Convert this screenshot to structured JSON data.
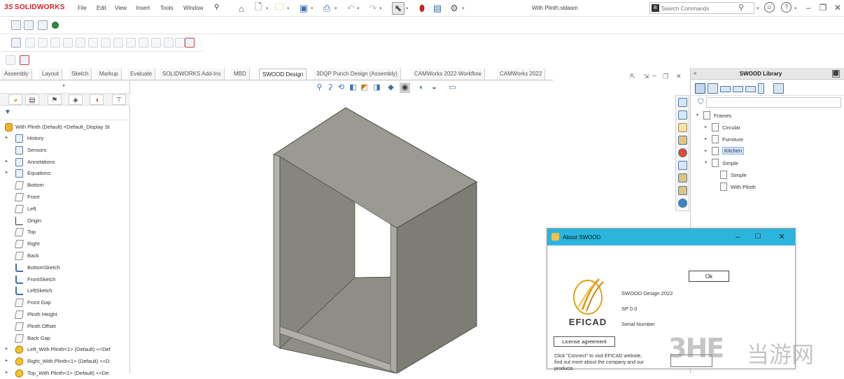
{
  "title_bar": {
    "logo_text": "SOLIDWORKS",
    "logo_mark": "3S",
    "menus": [
      "File",
      "Edit",
      "View",
      "Insert",
      "Tools",
      "Window"
    ],
    "document_title": "With Plinth.sldasm",
    "search_placeholder": "Search Commands",
    "search_logo": "B"
  },
  "command_tabs": [
    "Assembly",
    "Layout",
    "Sketch",
    "Markup",
    "Evaluate",
    "SOLIDWORKS Add-Ins",
    "MBD",
    "SWOOD Design",
    "3DQP Punch Design (Assembly)",
    "CAMWorks 2022-Workflow",
    "CAMWorks 2022"
  ],
  "active_command_tab": "SWOOD Design",
  "feature_tree": {
    "filter_symbol": "▼",
    "root": "With Plinth (Default) <Default_Display St",
    "items": [
      {
        "label": "History",
        "icon": "history-icon",
        "expand": "▸"
      },
      {
        "label": "Sensors",
        "icon": "sensors-icon",
        "expand": ""
      },
      {
        "label": "Annotations",
        "icon": "annotations-icon",
        "expand": "▸"
      },
      {
        "label": "Equations",
        "icon": "equations-icon",
        "expand": "▸"
      },
      {
        "label": "Bottom",
        "icon": "plane-icon",
        "expand": ""
      },
      {
        "label": "Front",
        "icon": "plane-icon",
        "expand": ""
      },
      {
        "label": "Left",
        "icon": "plane-icon",
        "expand": ""
      },
      {
        "label": "Origin",
        "icon": "origin-icon",
        "expand": ""
      },
      {
        "label": "Top",
        "icon": "plane-icon",
        "expand": ""
      },
      {
        "label": "Right",
        "icon": "plane-icon",
        "expand": ""
      },
      {
        "label": "Back",
        "icon": "plane-icon",
        "expand": ""
      },
      {
        "label": "BottomSketch",
        "icon": "sketch-icon",
        "expand": ""
      },
      {
        "label": "FrontSketch",
        "icon": "sketch-icon",
        "expand": ""
      },
      {
        "label": "LeftSketch",
        "icon": "sketch-icon",
        "expand": ""
      },
      {
        "label": "Front Gap",
        "icon": "plane-icon",
        "expand": ""
      },
      {
        "label": "Plinth Height",
        "icon": "plane-icon",
        "expand": ""
      },
      {
        "label": "Plinth Offset",
        "icon": "plane-icon",
        "expand": ""
      },
      {
        "label": "Back Gap",
        "icon": "plane-icon",
        "expand": ""
      },
      {
        "label": "Left_With Plinth<1> (Default) <<Def",
        "icon": "part-icon",
        "expand": "▸"
      },
      {
        "label": "Right_With Plinth<1> (Default) <<D",
        "icon": "part-icon",
        "expand": "▸"
      },
      {
        "label": "Top_With Plinth<1> (Default) <<De",
        "icon": "part-icon",
        "expand": "▸"
      }
    ]
  },
  "swood_library": {
    "title": "SWOOD Library",
    "close_symbol": "«",
    "tree": [
      {
        "label": "Frames",
        "level": 0,
        "expand": "▾",
        "selected": false
      },
      {
        "label": "Circular",
        "level": 1,
        "expand": "▸",
        "selected": false
      },
      {
        "label": "Furniture",
        "level": 1,
        "expand": "▸",
        "selected": false
      },
      {
        "label": "Kitchen",
        "level": 1,
        "expand": "▸",
        "selected": true
      },
      {
        "label": "Simple",
        "level": 1,
        "expand": "▾",
        "selected": false
      },
      {
        "label": "Simple",
        "level": 2,
        "expand": "",
        "selected": false
      },
      {
        "label": "With Plinth",
        "level": 2,
        "expand": "",
        "selected": false
      }
    ]
  },
  "about_dialog": {
    "title": "About SWOOD",
    "product": "SWOOD Design 2022",
    "service_pack": "SP 0.0",
    "serial_label": "Serial Number",
    "ok_label": "Ok",
    "license_label": "License agreement",
    "connect_text": "Click \"Connect\" to visit EFICAD website, find out more about the company and our products",
    "logo_text": "EFICAD"
  },
  "watermark": {
    "logo": "3HE",
    "text": "当游网"
  },
  "colors": {
    "dialog_title_bar": "#2bb5dd",
    "cabinet_top": "#9a9a92",
    "cabinet_side": "#86867e",
    "logo_red": "#d41f26"
  }
}
